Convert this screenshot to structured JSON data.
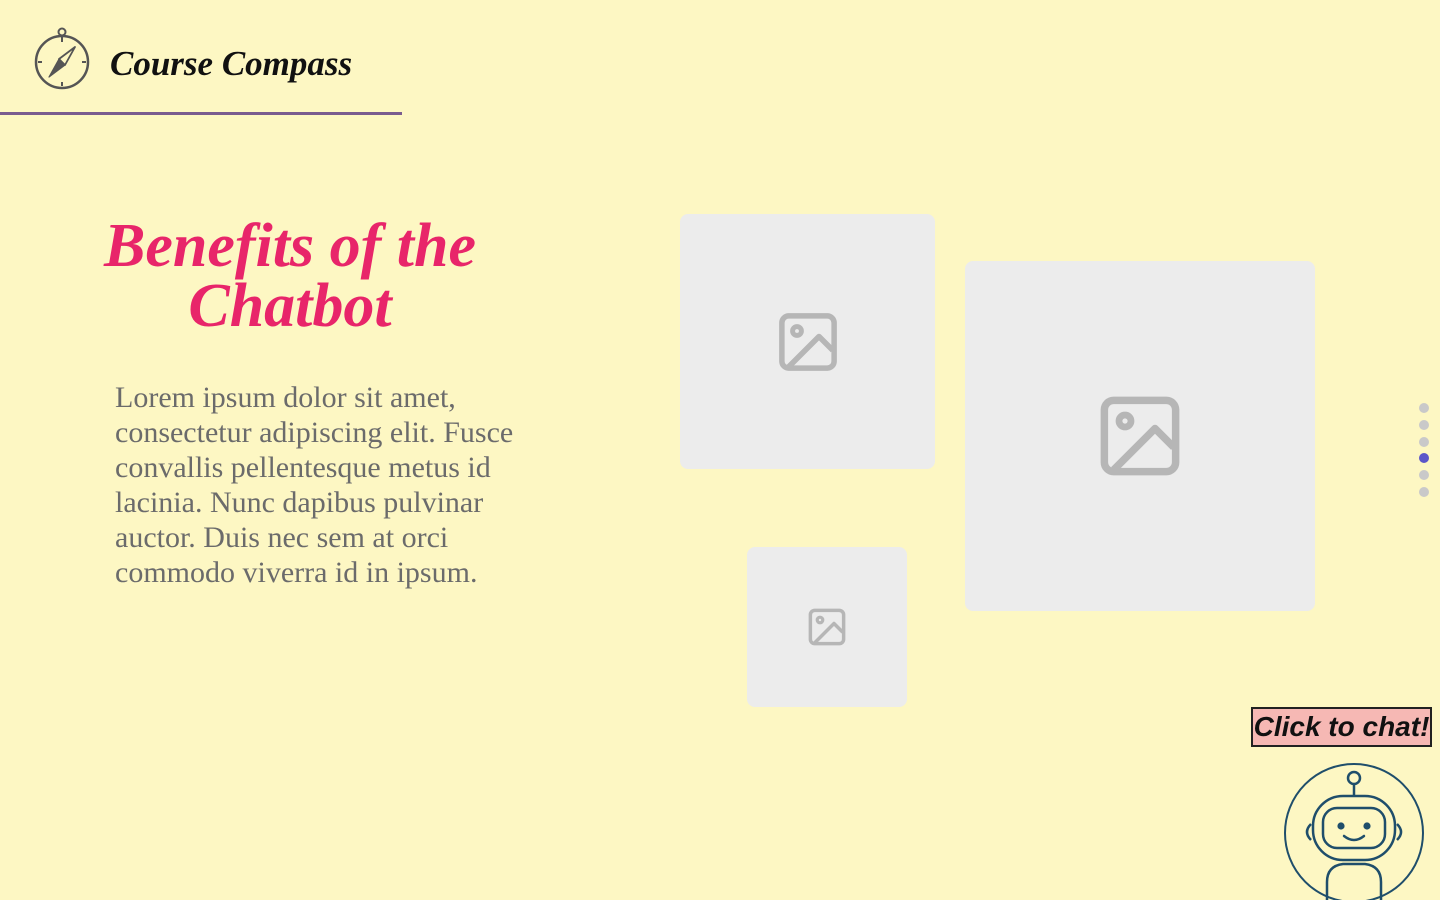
{
  "header": {
    "brand": "Course Compass",
    "logo_icon": "compass-icon",
    "rule_color": "#7a5c8f"
  },
  "hero": {
    "title": "Benefits of the Chatbot",
    "title_color": "#e8256a",
    "body": "Lorem ipsum dolor sit amet, consectetur adipiscing elit. Fusce convallis pellentesque metus id lacinia. Nunc dapibus pulvinar auctor. Duis nec sem at orci commodo viverra id in ipsum.",
    "body_color": "#6b6b6b"
  },
  "gallery": {
    "image_icon": "image-placeholder-icon",
    "placeholder_count": 3
  },
  "pagination": {
    "total": 6,
    "active_index": 3,
    "active_color": "#5b56c9"
  },
  "chat": {
    "button_label": "Click to chat!",
    "button_color": "#f6b8b4",
    "avatar_icon": "robot-icon"
  },
  "colors": {
    "background": "#fdf7c3"
  }
}
